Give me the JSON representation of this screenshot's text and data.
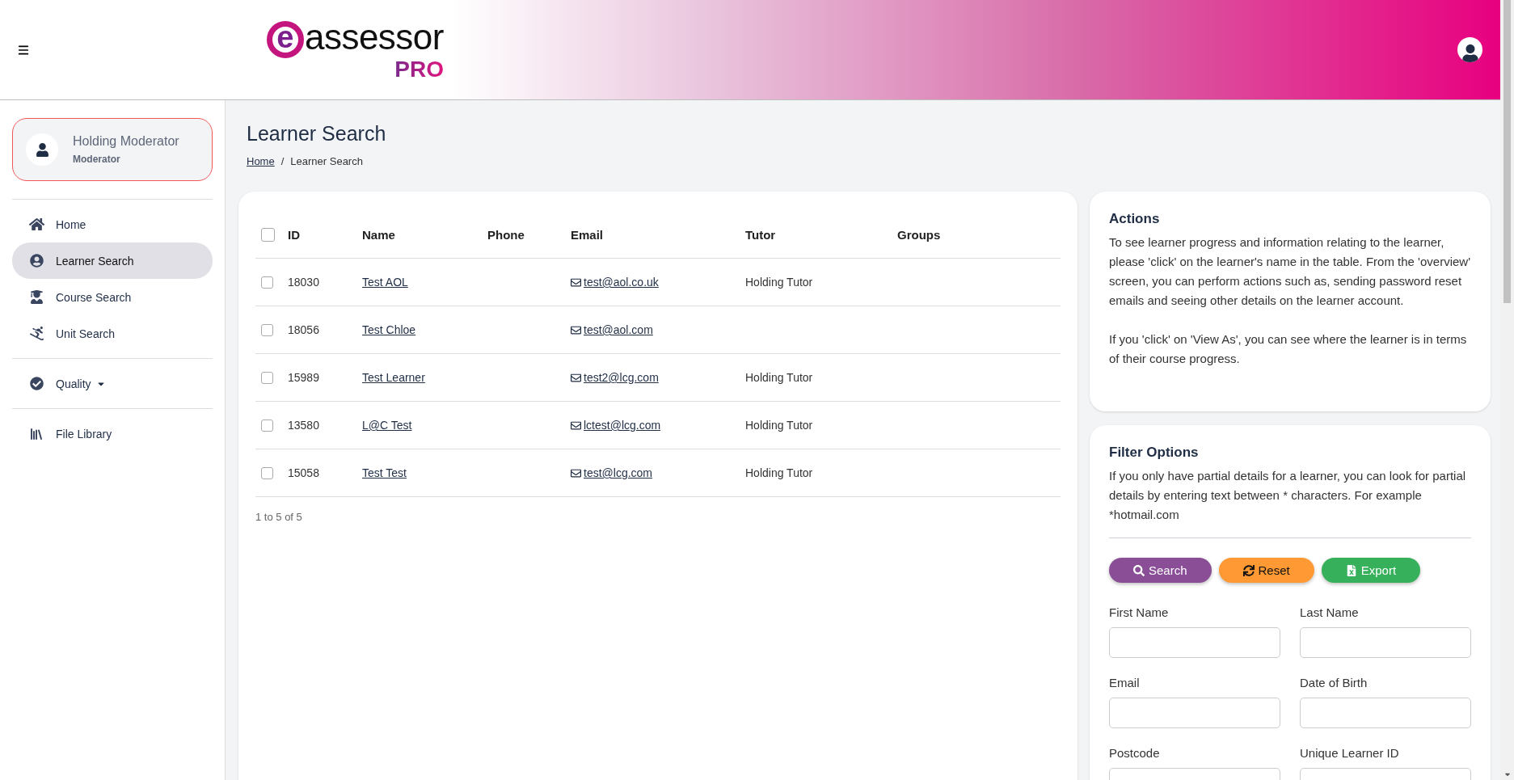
{
  "header": {
    "logo": {
      "letter": "e",
      "word": "assessor",
      "sub": "PRO"
    }
  },
  "profile": {
    "name": "Holding Moderator",
    "role": "Moderator"
  },
  "sidebar": {
    "sections": [
      {
        "items": [
          {
            "label": "Home",
            "kind": "home",
            "selected": false
          },
          {
            "label": "Learner Search",
            "kind": "learners",
            "selected": true
          },
          {
            "label": "Course Search",
            "kind": "courses",
            "selected": false
          },
          {
            "label": "Unit Search",
            "kind": "units",
            "selected": false
          }
        ]
      },
      {
        "items": [
          {
            "label": "Quality",
            "kind": "quality",
            "selected": false,
            "dropdown": true
          }
        ]
      },
      {
        "items": [
          {
            "label": "File Library",
            "kind": "library",
            "selected": false
          }
        ]
      }
    ]
  },
  "page": {
    "title": "Learner Search",
    "separator": "/",
    "breadcrumb": [
      {
        "label": "Home",
        "link": true
      },
      {
        "label": "Learner Search",
        "link": false
      }
    ]
  },
  "table": {
    "select_all_checked": false,
    "columns": [
      "ID",
      "Name",
      "Phone",
      "Email",
      "Tutor",
      "Groups"
    ],
    "rows": [
      {
        "checked": false,
        "id": "18030",
        "name": "Test AOL",
        "email": "test@aol.co.uk",
        "tutor": "Holding Tutor"
      },
      {
        "checked": false,
        "id": "18056",
        "name": "Test Chloe",
        "email": "test@aol.com"
      },
      {
        "checked": false,
        "id": "15989",
        "name": "Test Learner",
        "email": "test2@lcg.com",
        "tutor": "Holding Tutor"
      },
      {
        "checked": false,
        "id": "13580",
        "name": "L@C Test",
        "email": "lctest@lcg.com",
        "tutor": "Holding Tutor"
      },
      {
        "checked": false,
        "id": "15058",
        "name": "Test Test",
        "email": "test@lcg.com",
        "tutor": "Holding Tutor"
      }
    ],
    "footer": "1 to 5 of 5"
  },
  "actions": {
    "title": "Actions",
    "paragraphs": [
      "To see learner progress and information relating to the learner, please 'click' on the learner's name in the table. From the 'overview' screen, you can perform actions such as, sending password reset emails and seeing other details on the learner account.",
      "If you 'click' on 'View As', you can see where the learner is in terms of their course progress."
    ]
  },
  "filter": {
    "title": "Filter Options",
    "description": "If you only have partial details for a learner, you can look for partial details by entering text between * characters. For example *hotmail.com",
    "buttons": [
      {
        "label": "Search",
        "kind": "search"
      },
      {
        "label": "Reset",
        "kind": "reset"
      },
      {
        "label": "Export",
        "kind": "export"
      }
    ],
    "fields": [
      {
        "label": "First Name"
      },
      {
        "label": "Last Name"
      },
      {
        "label": "Email"
      },
      {
        "label": "Date of Birth"
      },
      {
        "label": "Postcode"
      },
      {
        "label": "Unique Learner ID"
      }
    ]
  }
}
